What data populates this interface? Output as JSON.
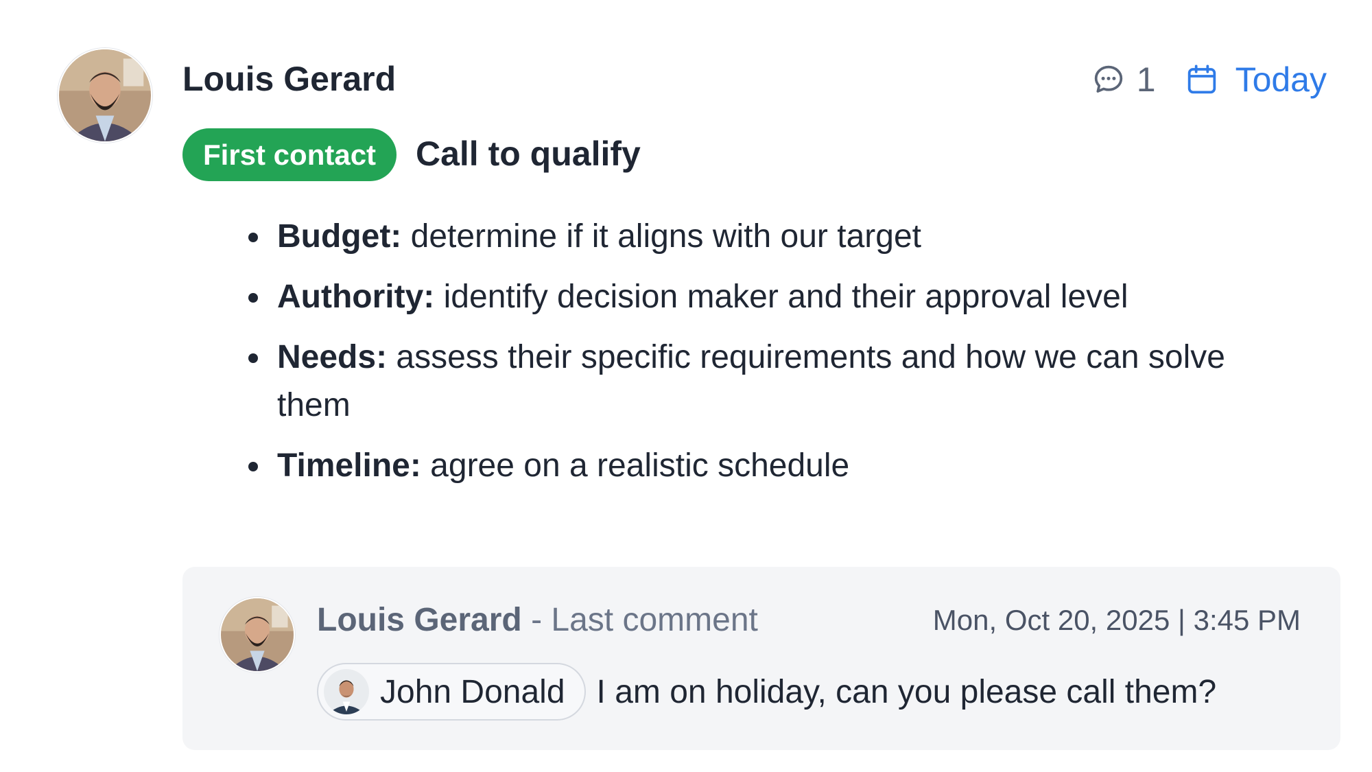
{
  "task": {
    "author": "Louis Gerard",
    "comment_count": "1",
    "due_label": "Today",
    "stage_badge": "First contact",
    "title": "Call to qualify",
    "bullets": [
      {
        "term": "Budget:",
        "text": " determine if it aligns with our target"
      },
      {
        "term": "Authority:",
        "text": " identify decision maker and their approval level"
      },
      {
        "term": "Needs:",
        "text": " assess their specific requirements and how we can solve them"
      },
      {
        "term": "Timeline:",
        "text": " agree on a realistic schedule"
      }
    ]
  },
  "last_comment": {
    "author": "Louis Gerard",
    "label": " - Last comment",
    "date": "Mon, Oct 20, 2025 | 3:45 PM",
    "mention": "John Donald",
    "text": "I am on holiday, can you please call them?"
  },
  "icons": {
    "comment": "comment-bubble-icon",
    "calendar": "calendar-icon"
  },
  "colors": {
    "badge": "#23a455",
    "accent": "#2f7be8",
    "comment_bg": "#f4f5f7"
  }
}
